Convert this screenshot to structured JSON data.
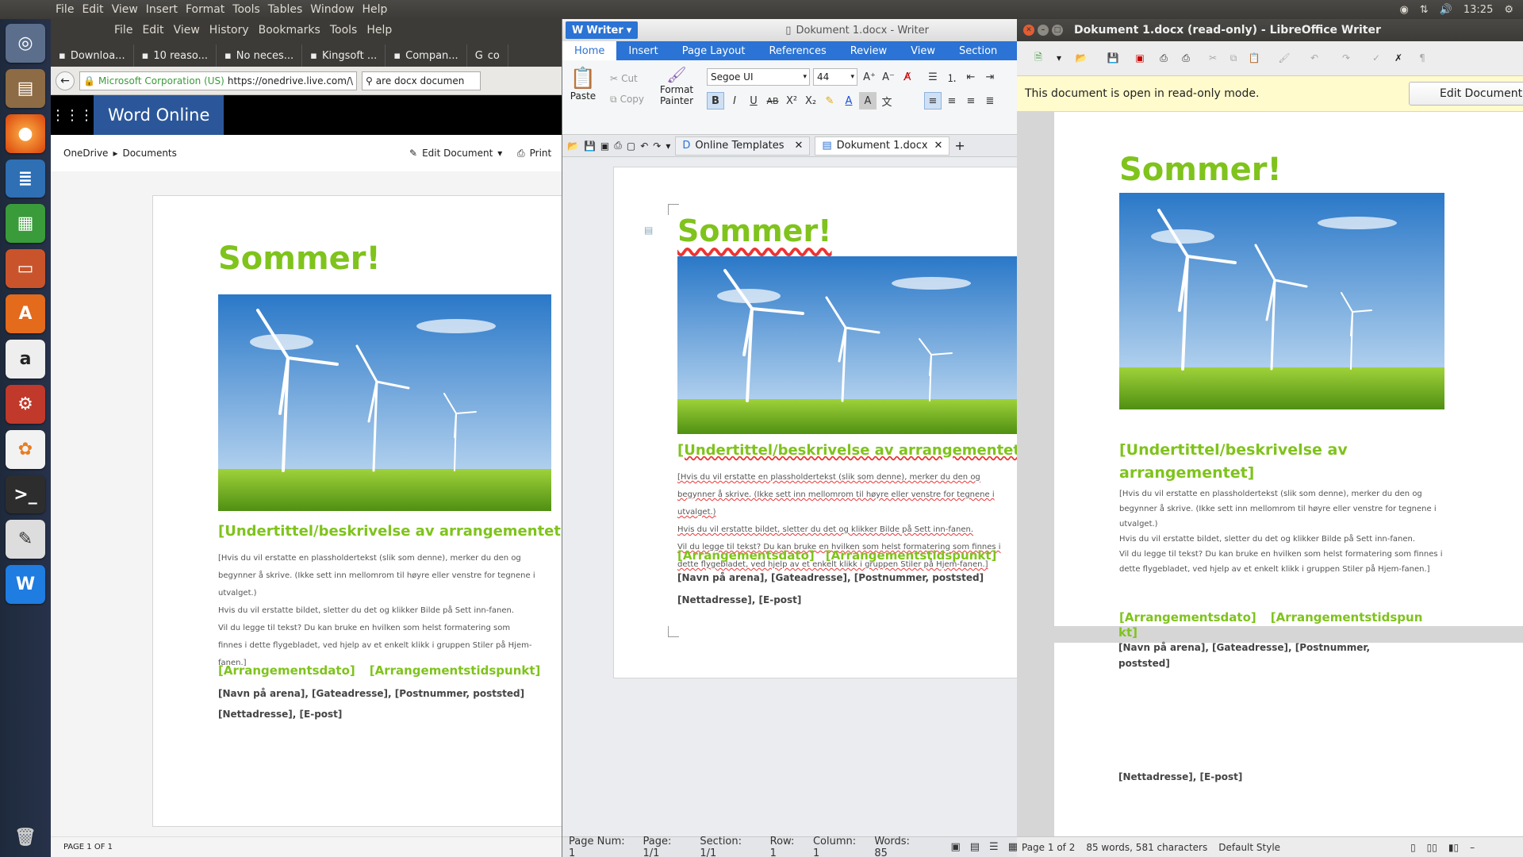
{
  "topbar": {
    "menus": [
      "File",
      "Edit",
      "View",
      "Insert",
      "Format",
      "Tools",
      "Tables",
      "Window",
      "Help"
    ],
    "clock": "13:25"
  },
  "launcher": {
    "items": [
      "ubuntu-dash",
      "file-manager",
      "firefox",
      "writer",
      "calc",
      "impress",
      "software-center",
      "amazon",
      "system-settings",
      "photo-app",
      "terminal",
      "text-editor",
      "wps-writer",
      "trash"
    ]
  },
  "firefox": {
    "menus": [
      "File",
      "Edit",
      "View",
      "History",
      "Bookmarks",
      "Tools",
      "Help"
    ],
    "tabs": [
      "Downloa...",
      "10 reaso...",
      "No neces...",
      "Kingsoft ...",
      "Compan...",
      "co"
    ],
    "identity": "Microsoft Corporation (US)",
    "url": "https://onedrive.live.com/\\",
    "search_value": "are docx documen",
    "word_online_title": "Word Online",
    "breadcrumb": [
      "OneDrive",
      "Documents"
    ],
    "edit_document": "Edit Document",
    "print": "Print",
    "status": "PAGE 1 OF 1"
  },
  "document": {
    "title": "Sommer!",
    "subtitle": "[Undertittel/beskrivelse av arrangementet]",
    "p1": "[Hvis du vil erstatte en plassholdertekst (slik som denne), merker du den og begynner å skrive. (Ikke sett inn mellomrom til høyre eller venstre for tegnene i utvalget.)",
    "p2": "Hvis du vil erstatte bildet, sletter du det og klikker Bilde på Sett inn-fanen.",
    "p3": "Vil du legge til tekst? Du kan bruke en hvilken som helst formatering som finnes i dette flygebladet, ved hjelp av et enkelt klikk i gruppen Stiler på Hjem-fanen.]",
    "date": "[Arrangementsdato]",
    "time": "[Arrangementstidspunkt]",
    "time_lo_1": "[Arrangementstidspun",
    "time_lo_2": "kt]",
    "address": "[Navn på arena], [Gateadresse], [Postnummer, poststed]",
    "web": "[Nettadresse], [E-post]"
  },
  "wps": {
    "app": "Writer",
    "window_title": "Dokument 1.docx - Writer",
    "menus": [
      "Home",
      "Insert",
      "Page Layout",
      "References",
      "Review",
      "View",
      "Section"
    ],
    "paste": "Paste",
    "cut": "Cut",
    "copy": "Copy",
    "format_painter_1": "Format",
    "format_painter_2": "Painter",
    "font": "Segoe UI",
    "size": "44",
    "tab_templates": "Online Templates",
    "tab_doc": "Dokument 1.docx",
    "status": [
      "Page Num: 1",
      "Page: 1/1",
      "Section: 1/1",
      "Row: 1",
      "Column: 1",
      "Words: 85"
    ]
  },
  "libreoffice": {
    "window_title": "Dokument 1.docx (read-only) - LibreOffice Writer",
    "infobar": "This document is open in read-only mode.",
    "edit_button": "Edit Document",
    "status": [
      "Page 1 of 2",
      "85 words, 581 characters",
      "Default Style"
    ]
  },
  "colors": {
    "accent_green": "#7fc31c",
    "word_blue": "#2b579a",
    "wps_blue": "#2b73d4"
  }
}
